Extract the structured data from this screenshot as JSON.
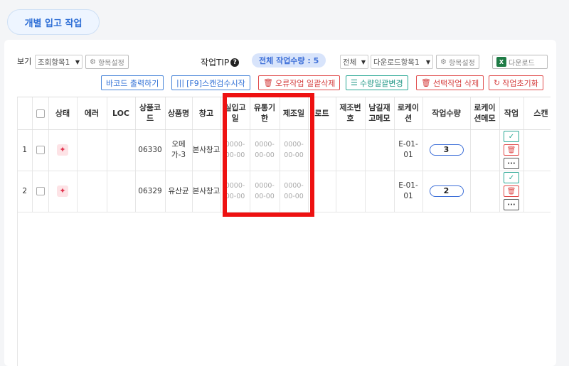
{
  "title": "개별 입고 작업",
  "toolbar": {
    "view_label": "보기",
    "view_select": "조회항목1",
    "item_settings": "항목설정",
    "tip_label": "작업TIP",
    "total_qty": "전체 작업수량 : 5",
    "scope_select": "전체",
    "download_select": "다운로드항목1",
    "download_settings": "항목설정",
    "download_btn": "다운로드"
  },
  "actions": {
    "barcode": "바코드 출력하기",
    "scan": "[F9]스캔검수시작",
    "delete_errors": "오류작업 일괄삭제",
    "bulk_qty": "수량일괄변경",
    "delete_selected": "선택작업 삭제",
    "reset": "작업초기화"
  },
  "columns": [
    "",
    "",
    "상태",
    "에러",
    "LOC",
    "상품코드",
    "상품명",
    "창고",
    "실입고일",
    "유통기한",
    "제조일",
    "로트",
    "제조번호",
    "남길재고메모",
    "로케이션",
    "작업수량",
    "로케이션메모",
    "작업",
    "스캔"
  ],
  "rows": [
    {
      "no": "1",
      "code": "06330",
      "name": "오메가-3",
      "warehouse": "본사창고",
      "in_date": "0000-00-00",
      "exp_date": "0000-00-00",
      "mfg_date": "0000-00-00",
      "location": "E-01-01",
      "qty": "3"
    },
    {
      "no": "2",
      "code": "06329",
      "name": "유산균",
      "warehouse": "본사창고",
      "in_date": "0000-00-00",
      "exp_date": "0000-00-00",
      "mfg_date": "0000-00-00",
      "location": "E-01-01",
      "qty": "2"
    }
  ],
  "colors": {
    "accent": "#3d6fd8",
    "highlight": "#ee1111",
    "danger": "#e04b4b",
    "ok": "#2aa895"
  }
}
